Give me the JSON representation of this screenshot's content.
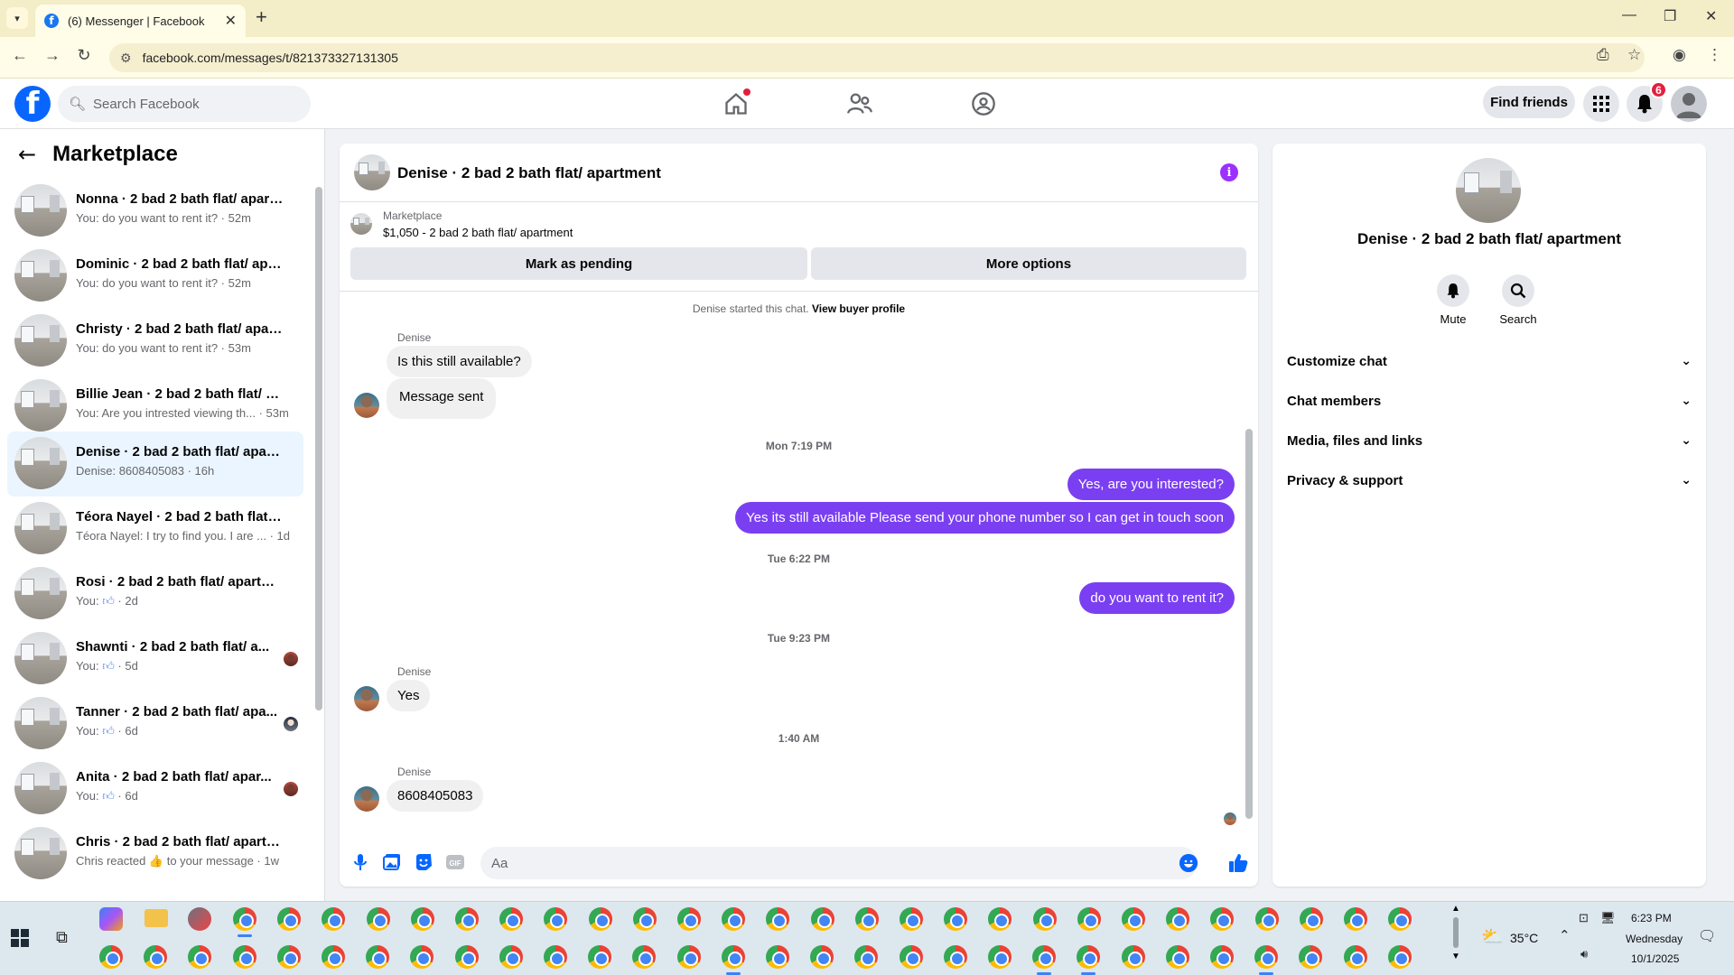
{
  "browser": {
    "tab_title": "(6) Messenger | Facebook",
    "url": "facebook.com/messages/t/821373327131305"
  },
  "fb": {
    "search_placeholder": "Search Facebook",
    "find_friends": "Find friends",
    "notifications_count": "6"
  },
  "sidebar": {
    "title": "Marketplace",
    "conversations": [
      {
        "name": "Nonna · 2 bad 2 bath flat/ apart...",
        "preview": "You: do you want to rent it? · 52m",
        "thumb_up": false
      },
      {
        "name": "Dominic · 2 bad 2 bath flat/ apa...",
        "preview": "You: do you want to rent it? · 52m",
        "thumb_up": false
      },
      {
        "name": "Christy · 2 bad 2 bath flat/ apart...",
        "preview": "You: do you want to rent it? · 53m",
        "thumb_up": false
      },
      {
        "name": "Billie Jean · 2 bad 2 bath flat/ ap...",
        "preview": "You: Are you intrested viewing th...  · 53m",
        "thumb_up": false
      },
      {
        "name": "Denise · 2 bad 2 bath flat/ apart...",
        "preview": "Denise: 8608405083 · 16h",
        "thumb_up": false,
        "active": true
      },
      {
        "name": "Téora Nayel · 2 bad 2 bath flat/ ...",
        "preview": "Téora Nayel: I try to find you. I are ... · 1d",
        "thumb_up": false
      },
      {
        "name": "Rosi · 2 bad 2 bath flat/ apartme...",
        "preview_prefix": "You:",
        "preview_suffix": "· 2d",
        "thumb_up": true
      },
      {
        "name": "Shawnti · 2 bad 2 bath flat/ a...",
        "preview_prefix": "You:",
        "preview_suffix": "· 5d",
        "thumb_up": true
      },
      {
        "name": "Tanner · 2 bad 2 bath flat/ apa...",
        "preview_prefix": "You:",
        "preview_suffix": "· 6d",
        "thumb_up": true
      },
      {
        "name": "Anita · 2 bad 2 bath flat/ apar...",
        "preview_prefix": "You:",
        "preview_suffix": "· 6d",
        "thumb_up": true
      },
      {
        "name": "Chris · 2 bad 2 bath flat/ apartm...",
        "preview": "Chris reacted 👍 to your message · 1w",
        "thumb_up": false
      }
    ]
  },
  "chat": {
    "title": "Denise · 2 bad 2 bath flat/ apartment",
    "marketplace_label": "Marketplace",
    "listing": "$1,050 - 2 bad 2 bath flat/ apartment",
    "mark_pending": "Mark as pending",
    "more_options": "More options",
    "started_text": "Denise started this chat.",
    "view_profile": "View buyer profile",
    "sender_name": "Denise",
    "msg_1": "Is this still available?",
    "msg_2": "Message sent",
    "time_1": "Mon 7:19 PM",
    "msg_3": "Yes, are you interested?",
    "msg_4": "Yes its still available Please send your phone number so I can get in touch soon",
    "time_2": "Tue 6:22 PM",
    "msg_5": "do you want to rent it?",
    "time_3": "Tue 9:23 PM",
    "msg_6": "Yes",
    "time_4": "1:40 AM",
    "msg_7": "8608405083",
    "composer_placeholder": "Aa"
  },
  "info_panel": {
    "title": "Denise · 2 bad 2 bath flat/ apartment",
    "mute": "Mute",
    "search": "Search",
    "sections": [
      "Customize chat",
      "Chat members",
      "Media, files and links",
      "Privacy & support"
    ]
  },
  "taskbar": {
    "weather": "35°C",
    "time": "6:23 PM",
    "day": "Wednesday",
    "date": "10/1/2025"
  },
  "colors": {
    "fb_blue": "#0866ff",
    "outgoing_bubble": "#7b3ff2",
    "active_row": "#ebf5ff",
    "badge_red": "#e41e3f"
  }
}
